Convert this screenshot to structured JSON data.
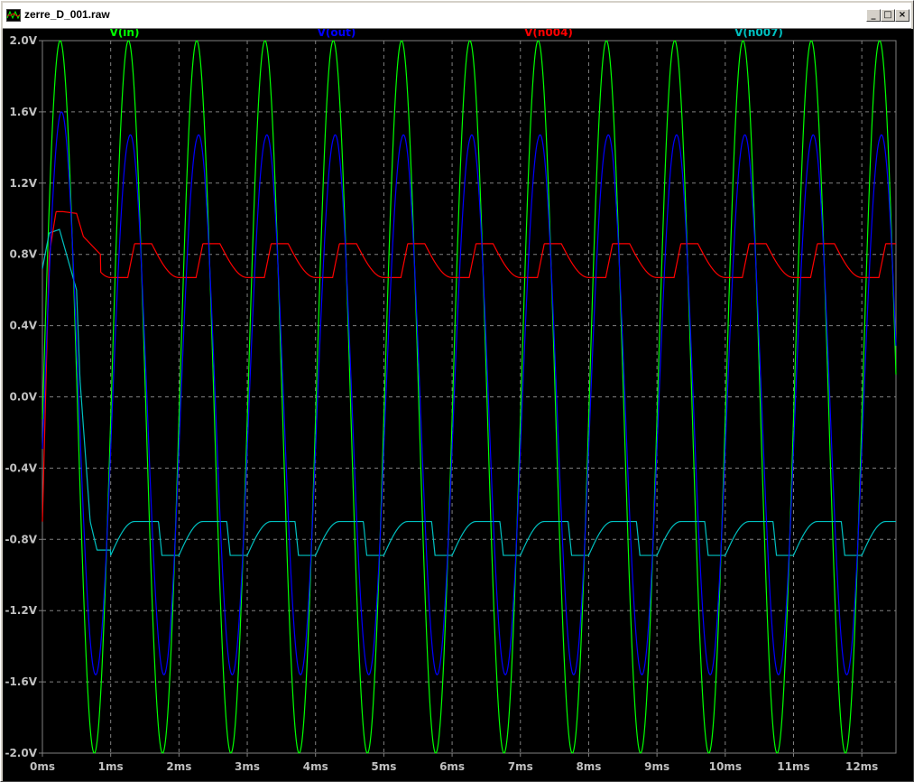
{
  "window": {
    "title": "zerre_D_001.raw",
    "minimize_label": "_",
    "maximize_label": "□",
    "close_label": "×"
  },
  "colors": {
    "background": "#000000",
    "axis": "#808080",
    "grid": "#808080",
    "tick_label": "#c0c0c0"
  },
  "chart_data": {
    "type": "line",
    "xlabel": "",
    "ylabel": "",
    "x_unit": "ms",
    "y_unit": "V",
    "xlim": [
      0,
      12.5
    ],
    "ylim": [
      -2.0,
      2.0
    ],
    "x_ticks": [
      0,
      1,
      2,
      3,
      4,
      5,
      6,
      7,
      8,
      9,
      10,
      11,
      12
    ],
    "x_tick_labels": [
      "0ms",
      "1ms",
      "2ms",
      "3ms",
      "4ms",
      "5ms",
      "6ms",
      "7ms",
      "8ms",
      "9ms",
      "10ms",
      "11ms",
      "12ms"
    ],
    "y_ticks": [
      2.0,
      1.6,
      1.2,
      0.8,
      0.4,
      0.0,
      -0.4,
      -0.8,
      -1.2,
      -1.6,
      -2.0
    ],
    "y_tick_labels": [
      "2.0V",
      "1.6V",
      "1.2V",
      "0.8V",
      "0.4V",
      "0.0V",
      "-0.4V",
      "-0.8V",
      "-1.2V",
      "-1.6V",
      "-2.0V"
    ],
    "grid": true,
    "legend": "top",
    "series": [
      {
        "name": "V(in)",
        "color": "#00ff00",
        "model": "sine",
        "amplitude": 2.0,
        "frequency_khz": 1.0,
        "offset_ms": 0.0
      },
      {
        "name": "V(out)",
        "color": "#0000ff",
        "model": "clipped-sine",
        "peak_positive": 1.46,
        "peak_negative": -1.56,
        "first_peak": 1.6
      },
      {
        "name": "V(n004)",
        "color": "#ff0000",
        "model": "ripple",
        "x": [
          0,
          0.1,
          0.2,
          0.3,
          0.5,
          0.6,
          0.85,
          1.0,
          1.25,
          1.35,
          1.6,
          1.85,
          2.0,
          2.25,
          2.35,
          2.6,
          2.85,
          3.0
        ],
        "y": [
          -0.7,
          0.8,
          1.04,
          1.04,
          1.03,
          0.9,
          0.8,
          0.68,
          0.68,
          0.86,
          0.86,
          0.76,
          0.67,
          0.67,
          0.86,
          0.86,
          0.76,
          0.67
        ],
        "high": 0.86,
        "low": 0.67
      },
      {
        "name": "V(n007)",
        "color": "#00c0c0",
        "model": "ripple",
        "x": [
          0,
          0.1,
          0.25,
          0.5,
          0.55,
          0.7,
          0.8,
          1.0,
          1.35,
          1.7,
          1.75,
          2.0,
          2.35,
          2.7,
          2.75,
          3.0
        ],
        "y": [
          0.72,
          0.92,
          0.94,
          0.6,
          0.1,
          -0.7,
          -0.86,
          -0.86,
          -0.68,
          -0.68,
          -0.88,
          -0.88,
          -0.72,
          -0.7,
          -0.89,
          -0.89
        ],
        "high": -0.7,
        "low": -0.89
      }
    ]
  }
}
